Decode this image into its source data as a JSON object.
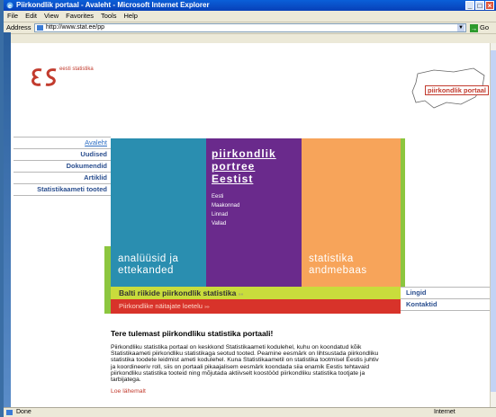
{
  "window": {
    "title": "Piirkondlik portaal - Avaleht - Microsoft Internet Explorer"
  },
  "menu": [
    "File",
    "Edit",
    "View",
    "Favorites",
    "Tools",
    "Help"
  ],
  "address": {
    "label": "Address",
    "url": "http://www.stat.ee/pp",
    "go": "Go"
  },
  "logo": {
    "text": "eesti statistika"
  },
  "portal_logo": {
    "text": "piirkondlik portaal"
  },
  "nav": [
    "Avaleht",
    "Uudised",
    "Dokumendid",
    "Artiklid",
    "Statistikaameti tooted"
  ],
  "tiles": {
    "analysis": "analüüsid ja ettekanded",
    "portrait_lines": [
      "piirkondlik",
      "portree",
      "Eestist"
    ],
    "portrait_subs": [
      "Eesti",
      "Maakonnad",
      "Linnad",
      "Vallad"
    ],
    "database": "statistika andmebaas"
  },
  "bars": {
    "baltic": "Balti riikide piirkondlik statistika",
    "indicators": "Piirkondlike näitajate loetelu",
    "more_mark": "»»"
  },
  "right_nav": [
    "Lingid",
    "Kontaktid"
  ],
  "welcome": {
    "title": "Tere tulemast piirkondliku statistika portaali!",
    "body": "Piirkondliku statistika portaal on keskkond Statistikaameti kodulehel, kuhu on koondatud kõik Statistikaameti piirkondliku statistikaga seotud tooted. Peamine eesmärk on lihtsustada piirkondliku statistika toodete leidmist ameti kodulehel. Kuna Statistikaametil on statistika tootmisel Eestis juhtiv ja koordineeriv roll, siis on portaali pikaajalisem eesmärk koondada siia enamik Eestis tehtavaid piirkondliku statistika tooteid ning mõjutada aktiivselt koostööd piirkondliku statistika tootjate ja tarbijatega.",
    "more": "Loe lähemalt"
  },
  "status": {
    "left": "Done",
    "right": "Internet"
  },
  "colors": {
    "blue_tile": "#2a8eb0",
    "purple_tile": "#6a2a8c",
    "orange_tile": "#f7a45a",
    "green": "#8cc63f",
    "red": "#d8332a"
  }
}
